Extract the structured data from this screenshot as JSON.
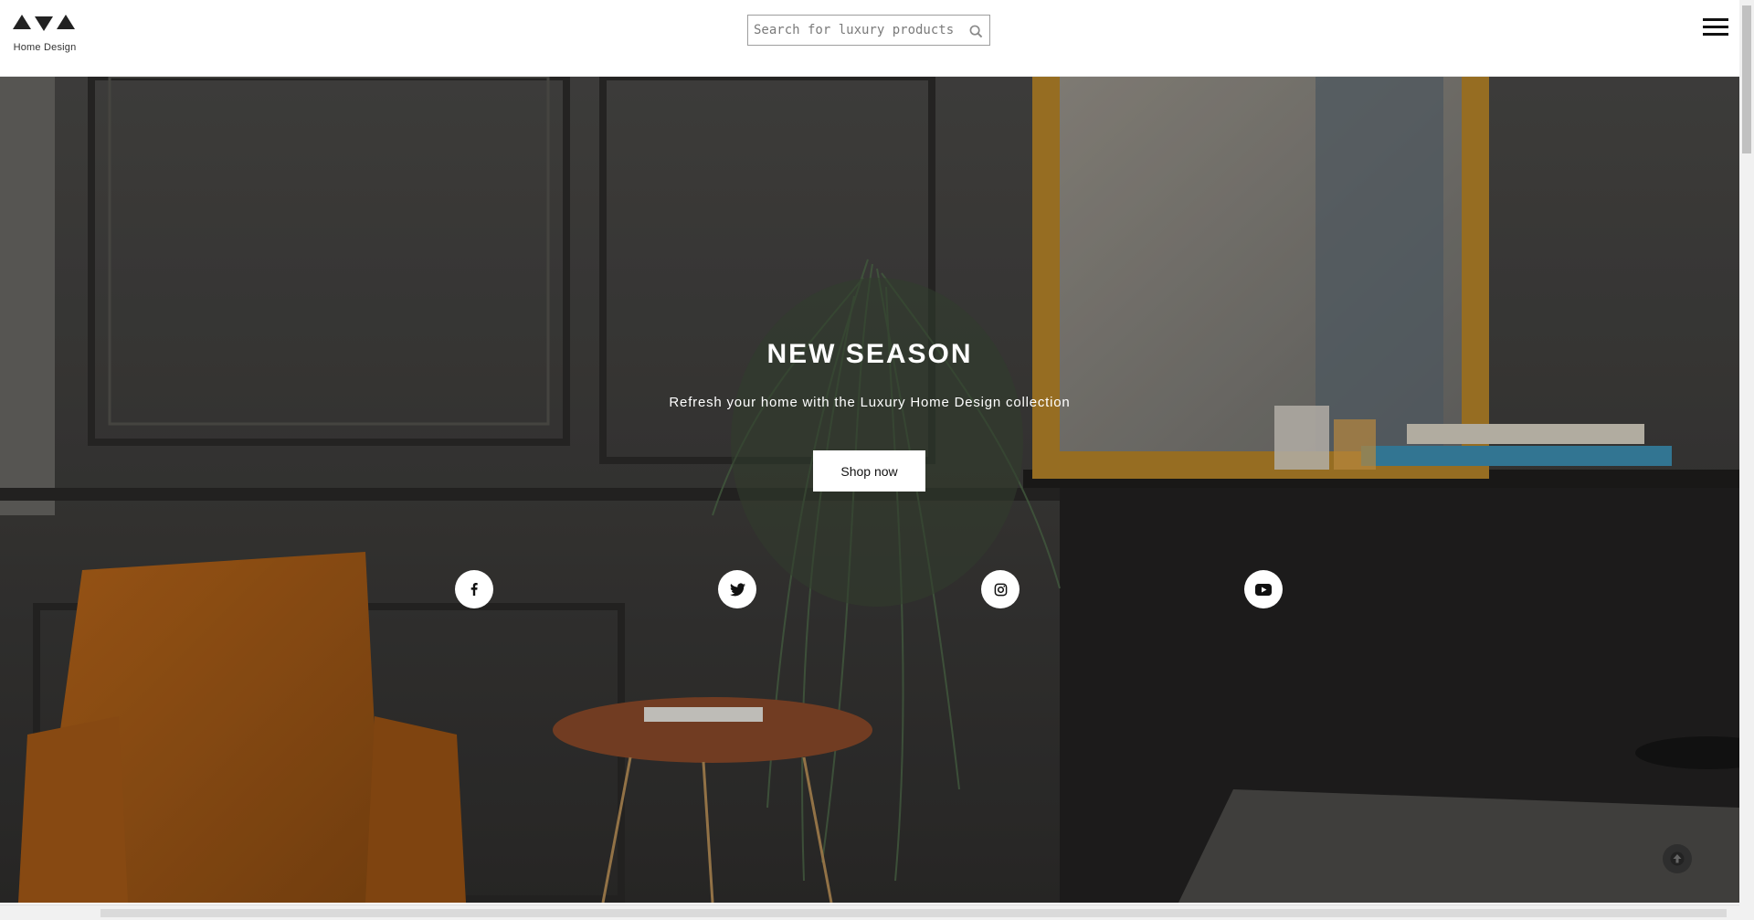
{
  "header": {
    "logo_text": "Home Design",
    "search": {
      "placeholder": "Search for luxury products",
      "value": ""
    },
    "search_icon": "search-icon",
    "menu_icon": "hamburger-menu-icon"
  },
  "hero": {
    "title": "NEW SEASON",
    "subtitle": "Refresh your home with the Luxury Home Design collection",
    "cta_label": "Shop now"
  },
  "social": [
    {
      "name": "facebook",
      "icon": "facebook-icon"
    },
    {
      "name": "twitter",
      "icon": "twitter-icon"
    },
    {
      "name": "instagram",
      "icon": "instagram-icon"
    },
    {
      "name": "youtube",
      "icon": "youtube-icon"
    }
  ],
  "scroll_top_icon": "arrow-up-icon",
  "colors": {
    "header_bg": "#ffffff",
    "hero_overlay": "#3b3a38",
    "button_bg": "#ffffff",
    "text_on_hero": "#ffffff"
  }
}
